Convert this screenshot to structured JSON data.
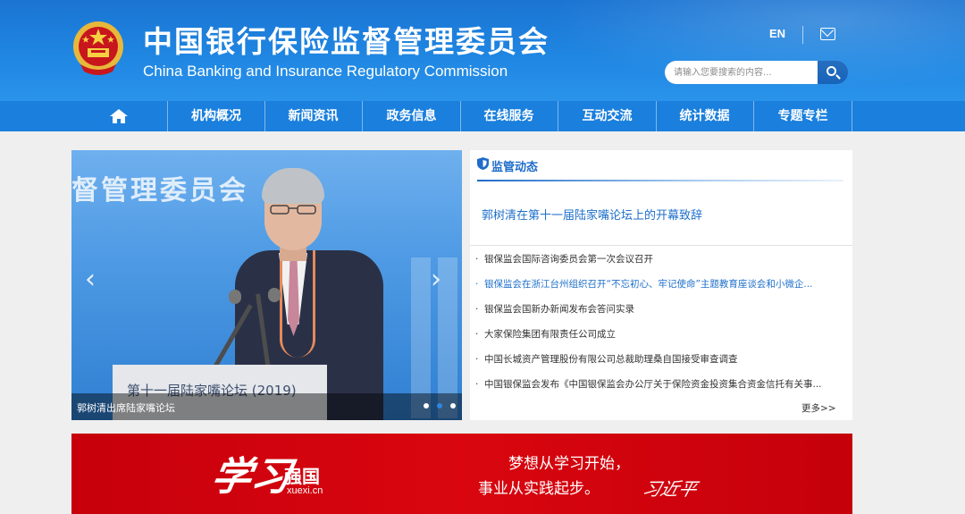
{
  "header": {
    "title_cn": "中国银行保险监督管理委员会",
    "title_en": "China Banking and Insurance Regulatory Commission",
    "lang_switch": "EN",
    "mail_icon": "mail-icon",
    "search": {
      "placeholder": "请输入您要搜索的内容...",
      "value": ""
    }
  },
  "nav": {
    "home_icon": "home-icon",
    "items": [
      {
        "label": "机构概况"
      },
      {
        "label": "新闻资讯"
      },
      {
        "label": "政务信息"
      },
      {
        "label": "在线服务"
      },
      {
        "label": "互动交流"
      },
      {
        "label": "统计数据"
      },
      {
        "label": "专题专栏"
      }
    ]
  },
  "slider": {
    "background_text": "督管理委员会",
    "podium_text": "第十一届陆家嘴论坛 (2019)",
    "caption": "郭树清出席陆家嘴论坛",
    "prev_icon": "chevron-left-icon",
    "next_icon": "chevron-right-icon",
    "dots_total": 3,
    "active_dot": 2
  },
  "news": {
    "title": "监管动态",
    "headline": "郭树清在第十一届陆家嘴论坛上的开幕致辞",
    "items": [
      {
        "text": "银保监会国际咨询委员会第一次会议召开",
        "highlight": false
      },
      {
        "text": "银保监会在浙江台州组织召开“不忘初心、牢记使命”主题教育座谈会和小微企...",
        "highlight": true
      },
      {
        "text": "银保监会国新办新闻发布会答问实录",
        "highlight": false
      },
      {
        "text": "大家保险集团有限责任公司成立",
        "highlight": false
      },
      {
        "text": "中国长城资产管理股份有限公司总裁助理桑自国接受审查调查",
        "highlight": false
      },
      {
        "text": "中国银保监会发布《中国银保监会办公厅关于保险资金投资集合资金信托有关事...",
        "highlight": false
      }
    ],
    "more": "更多>>"
  },
  "banner": {
    "logo_script": "学习",
    "logo_name": "强国",
    "logo_url": "xuexi.cn",
    "motto_line1": "梦想从学习开始，",
    "motto_line2": "事业从实践起步。",
    "signature": "习近平"
  },
  "colors": {
    "header_blue": "#1f86e2",
    "nav_blue": "#1a7fdd",
    "link_blue": "#1e6fca",
    "banner_red": "#d9060f"
  }
}
